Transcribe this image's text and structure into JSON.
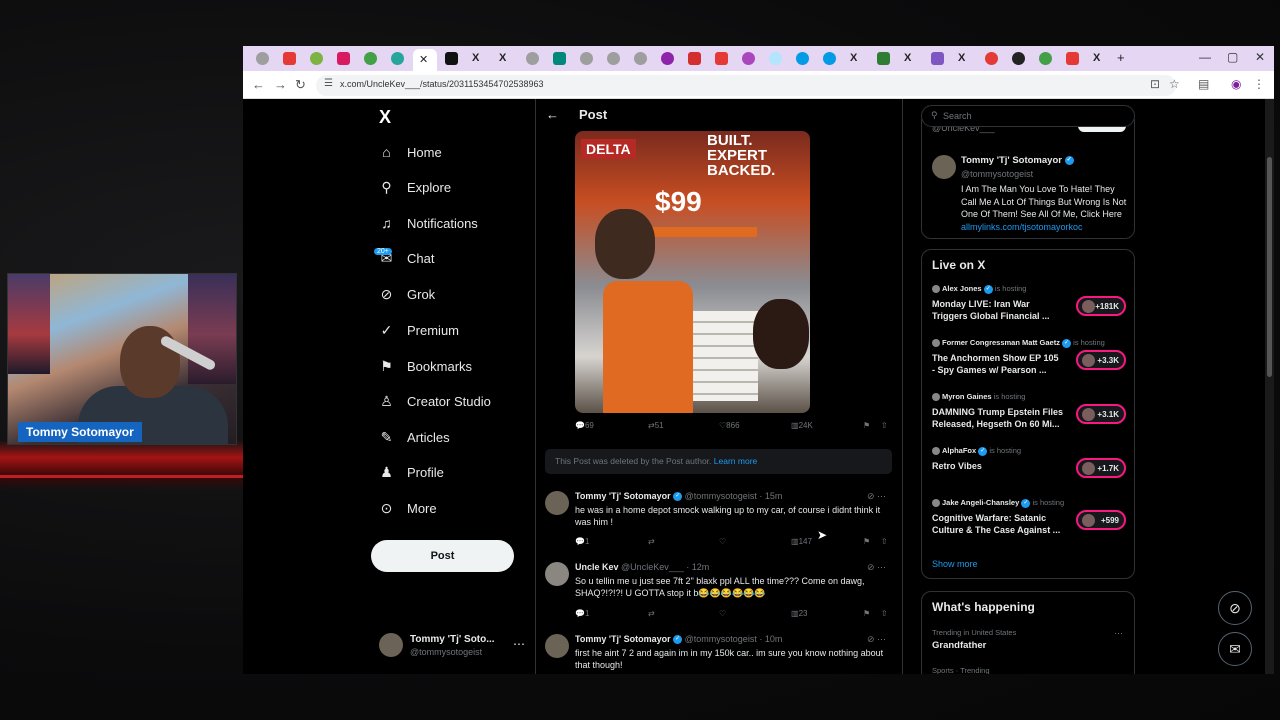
{
  "stream": {
    "webcam_name": "Tommy Sotomayor"
  },
  "browser": {
    "url": "x.com/UncleKev___/status/2031153454702538963",
    "active_tab_icon": "close-icon",
    "window_controls": [
      "—",
      "▢",
      "✕"
    ],
    "new_tab": "+"
  },
  "sidebar": {
    "logo": "X",
    "items": [
      {
        "label": "Home",
        "icon": "home-icon"
      },
      {
        "label": "Explore",
        "icon": "search-icon"
      },
      {
        "label": "Notifications",
        "icon": "bell-icon"
      },
      {
        "label": "Chat",
        "icon": "chat-icon",
        "badge": "20+"
      },
      {
        "label": "Grok",
        "icon": "grok-icon"
      },
      {
        "label": "Premium",
        "icon": "premium-icon"
      },
      {
        "label": "Bookmarks",
        "icon": "bookmark-icon"
      },
      {
        "label": "Creator Studio",
        "icon": "creator-studio-icon"
      },
      {
        "label": "Articles",
        "icon": "articles-icon"
      },
      {
        "label": "Profile",
        "icon": "profile-icon"
      },
      {
        "label": "More",
        "icon": "more-icon"
      }
    ],
    "post_button": "Post",
    "account": {
      "name": "Tommy 'Tj' Soto...",
      "handle": "@tommysotogeist"
    }
  },
  "main": {
    "title": "Post",
    "photo_text": {
      "delta": "DELTA",
      "expert": "BUILT. EXPERT BACKED.",
      "price": "$99"
    },
    "post_actions": {
      "replies": "69",
      "reposts": "51",
      "likes": "866",
      "views": "24K"
    },
    "deleted_notice": "This Post was deleted by the Post author.",
    "learn_more": "Learn more",
    "replies": [
      {
        "name": "Tommy 'Tj' Sotomayor",
        "meta": "@tommysotogeist · 15m",
        "text": "he was in a home depot smock walking up to my car, of course i didnt think it was him !",
        "replies": "1",
        "reposts": "",
        "likes": "",
        "views": "147"
      },
      {
        "name": "Uncle Kev",
        "meta": "@UncleKev___ · 12m",
        "text": "So u tellin me u just see 7ft 2\" blaxk ppl ALL the time??? Come on dawg, SHAQ?!?!?! U GOTTA stop it b😂😂😂😂😂😂",
        "replies": "1",
        "reposts": "",
        "likes": "",
        "views": "23"
      },
      {
        "name": "Tommy 'Tj' Sotomayor",
        "meta": "@tommysotogeist · 10m",
        "text": "first he aint 7 2 and again im in my 150k car.. im sure you know nothing about that though!"
      }
    ]
  },
  "right": {
    "search_placeholder": "Search",
    "ghost_handle": "@UncleKev___",
    "profile": {
      "name": "Tommy 'Tj' Sotomayor",
      "handle": "@tommysotogeist",
      "bio": "I Am The Man You Love To Hate! They Call Me A Lot Of Things But Wrong Is Not One Of Them! See All Of Me, Click Here",
      "link": "allmylinks.com/tjsotomayorkoc"
    },
    "live": {
      "title": "Live on X",
      "hosting_label": "is hosting",
      "items": [
        {
          "host": "Alex Jones",
          "title": "Monday LIVE: Iran War Triggers Global Financial ...",
          "count": "+181K"
        },
        {
          "host": "Former Congressman Matt Gaetz",
          "title": "The Anchormen Show EP 105 - Spy Games w/ Pearson ...",
          "count": "+3.3K"
        },
        {
          "host": "Myron Gaines",
          "title": "DAMNING Trump Epstein Files Released, Hegseth On 60 Mi...",
          "count": "+3.1K"
        },
        {
          "host": "AlphaFox",
          "title": "Retro Vibes",
          "count": "+1.7K"
        },
        {
          "host": "Jake Angeli-Chansley",
          "title": "Cognitive Warfare: Satanic Culture & The Case Against ...",
          "count": "+599"
        }
      ],
      "show_more": "Show more"
    },
    "happening": {
      "title": "What's happening",
      "trends": [
        {
          "context": "Trending in United States",
          "name": "Grandfather"
        },
        {
          "context": "Sports · Trending",
          "name": ""
        }
      ]
    }
  },
  "colors": {
    "accent": "#1d9bf0",
    "live_ring": "#f91880",
    "tabbar": "#e5d7f3"
  }
}
